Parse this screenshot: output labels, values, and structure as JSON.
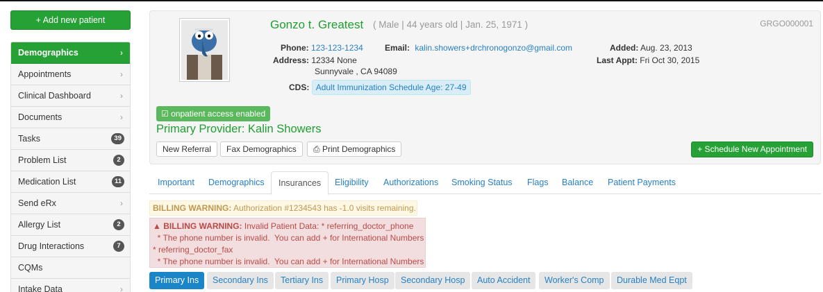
{
  "sidebar": {
    "add_label": "+ Add new patient",
    "items": [
      {
        "label": "Demographics",
        "active": true,
        "badge": null
      },
      {
        "label": "Appointments",
        "badge": null
      },
      {
        "label": "Clinical Dashboard",
        "badge": null
      },
      {
        "label": "Documents",
        "badge": null
      },
      {
        "label": "Tasks",
        "badge": "39"
      },
      {
        "label": "Problem List",
        "badge": "2"
      },
      {
        "label": "Medication List",
        "badge": "11"
      },
      {
        "label": "Send eRx",
        "badge": null
      },
      {
        "label": "Allergy List",
        "badge": "2"
      },
      {
        "label": "Drug Interactions",
        "badge": "7"
      },
      {
        "label": "CQMs",
        "badge": null
      },
      {
        "label": "Intake Data",
        "badge": null
      }
    ],
    "chevron": "›"
  },
  "patient": {
    "name": "Gonzo t. Greatest",
    "meta": "( Male | 44 years old | Jan. 25, 1971 )",
    "id": "GRGO000001",
    "phone_label": "Phone:",
    "phone": "123-123-1234",
    "email_label": "Email:",
    "email": "kalin.showers+drchronogonzo@gmail.com",
    "address_label": "Address:",
    "address_line1": "12334 None",
    "address_line2": "Sunnyvale , CA 94089",
    "added_label": "Added:",
    "added": "Aug. 23, 2013",
    "last_appt_label": "Last Appt:",
    "last_appt": "Fri Oct 30, 2015",
    "cds_label": "CDS:",
    "cds": "Adult Immunization Schedule Age: 27-49",
    "portal_label": "☑ onpatient access enabled",
    "provider": "Primary Provider: Kalin Showers"
  },
  "actions": {
    "new_referral": "New Referral",
    "fax": "Fax Demographics",
    "print": "Print Demographics",
    "schedule": "+ Schedule New Appointment"
  },
  "tabs": [
    "Important",
    "Demographics",
    "Insurances",
    "Eligibility",
    "Authorizations",
    "Smoking Status",
    "Flags",
    "Balance",
    "Patient Payments"
  ],
  "active_tab": "Insurances",
  "warnings": {
    "w1_bold": "BILLING WARNING:",
    "w1_text": " Authorization #1234543 has -1.0 visits remaining.",
    "w2_bold": "BILLING WARNING:",
    "w2_text": " Invalid Patient Data: * referring_doctor_phone",
    "w2_line2": "  * The phone number is invalid.  You can add + for International Numbers",
    "w2_line3": "* referring_doctor_fax",
    "w2_line4": "  * The phone number is invalid.  You can add + for International Numbers"
  },
  "subtabs": [
    "Primary Ins",
    "Secondary Ins",
    "Tertiary Ins",
    "Primary Hosp",
    "Secondary Hosp",
    "Auto Accident",
    "Worker's Comp",
    "Durable Med Eqpt"
  ],
  "colors": {
    "primary_green": "#25a135",
    "link_blue": "#2780c4",
    "active_blue": "#1a85c7"
  }
}
